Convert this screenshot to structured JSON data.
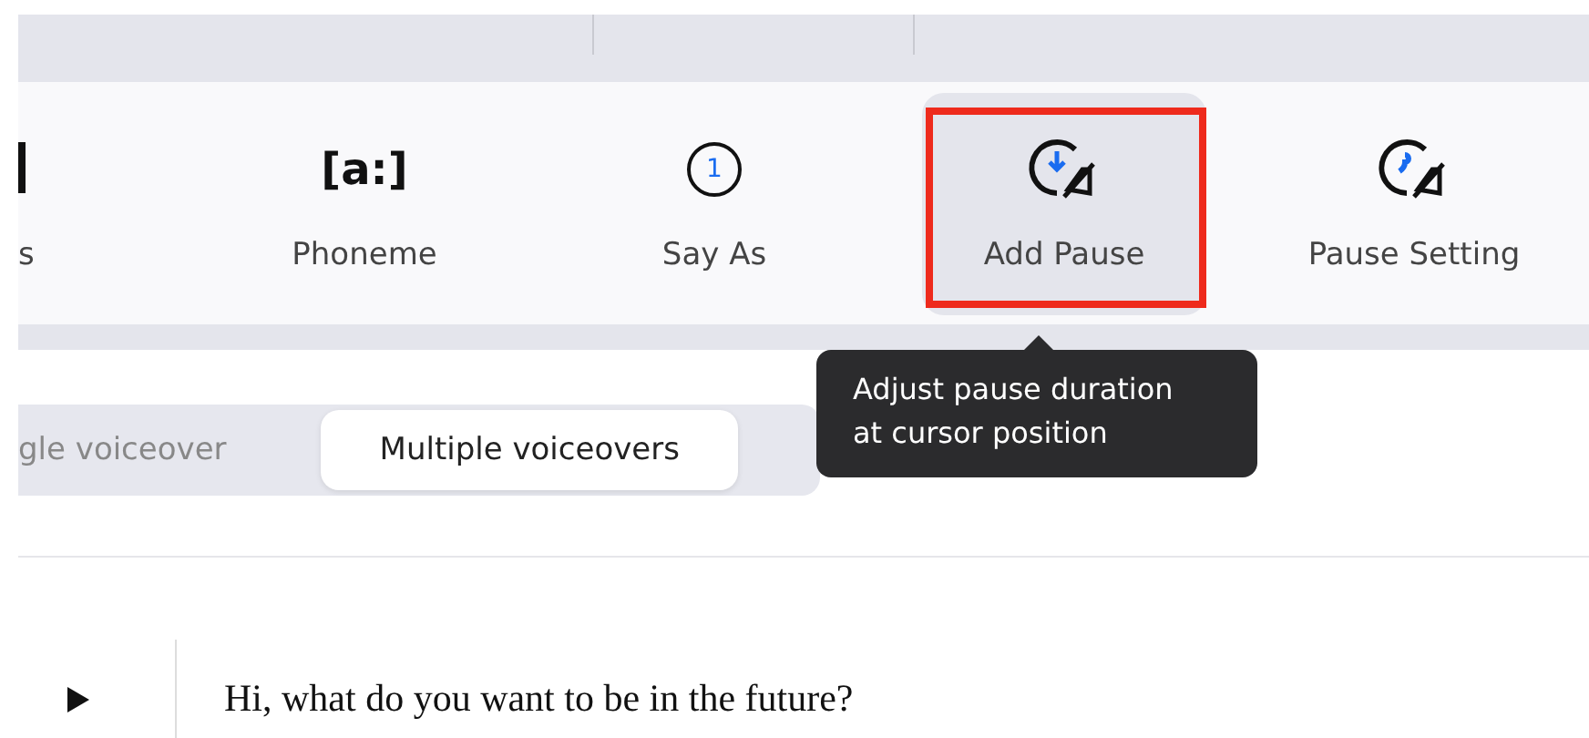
{
  "toolbar": {
    "tools": [
      {
        "kind": "cut",
        "label": "s"
      },
      {
        "kind": "phoneme",
        "label": "Phoneme",
        "icon_text": "[a:]",
        "selected": false,
        "annotated": false
      },
      {
        "kind": "sayas",
        "label": "Say As",
        "icon_text": "1",
        "selected": false,
        "annotated": false
      },
      {
        "kind": "pause",
        "label": "Add Pause",
        "selected": true,
        "annotated": true
      },
      {
        "kind": "setting",
        "label": "Pause Setting",
        "selected": false,
        "annotated": false
      }
    ]
  },
  "tooltip": {
    "text": "Adjust pause duration at cursor position"
  },
  "voiceover_modes": [
    {
      "label": "gle voiceover",
      "selected": false
    },
    {
      "label": "Multiple voiceovers",
      "selected": true
    }
  ],
  "lines": [
    {
      "text": "Hi, what do you want to be in the future?"
    }
  ]
}
